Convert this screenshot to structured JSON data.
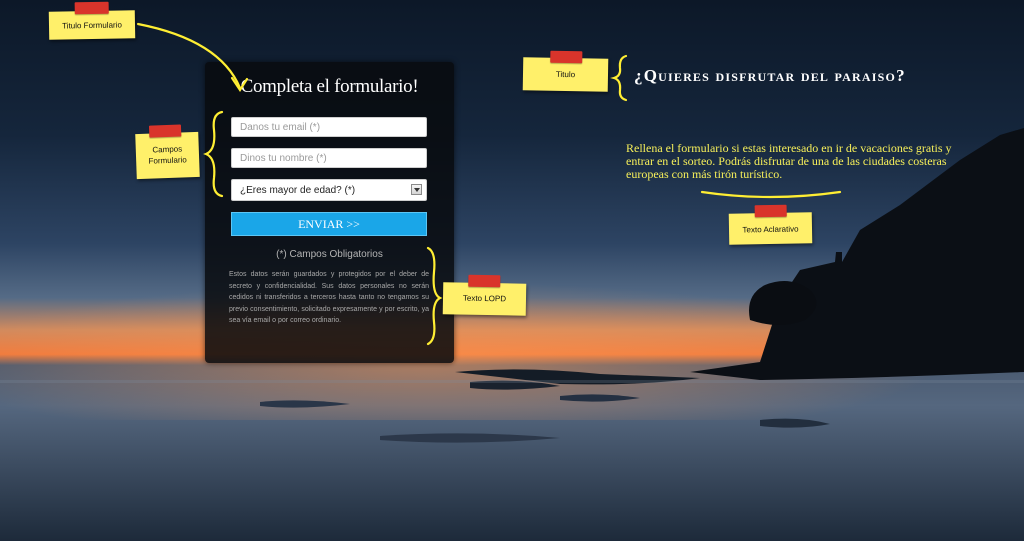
{
  "form": {
    "title": "Completa el formulario!",
    "email_placeholder": "Danos tu email (*)",
    "name_placeholder": "Dinos tu nombre (*)",
    "age_select_value": "¿Eres mayor de edad? (*)",
    "send_label": "ENVIAR >>",
    "required_note": "(*) Campos Obligatorios",
    "lopd_text": "Estos datos serán guardados y protegidos por el deber de secreto y confidencialidad. Sus datos personales no serán cedidos ni transferidos a terceros hasta tanto no tengamos su previo consentimiento, solicitado expresamente y por escrito, ya sea vía email o por correo ordinario."
  },
  "hero": {
    "headline": "¿Quieres disfrutar del paraiso?",
    "blurb": "Rellena el formulario si estas interesado en ir de vacaciones gratis y entrar en el sorteo. Podrás disfrutar de una de las ciudades costeras europeas con más tirón turístico."
  },
  "annotations": {
    "titulo_formulario": "Titulo Formulario",
    "campos_formulario": "Campos Formulario",
    "titulo": "Titulo",
    "texto_aclarativo": "Texto Aclarativo",
    "texto_lopd": "Texto LOPD"
  },
  "colors": {
    "accent_button": "#1aa6e8",
    "sticky_note": "#fff06a",
    "tape": "#d9342b",
    "blurb_text": "#f7f05a",
    "annotation_line": "#ffee33"
  }
}
